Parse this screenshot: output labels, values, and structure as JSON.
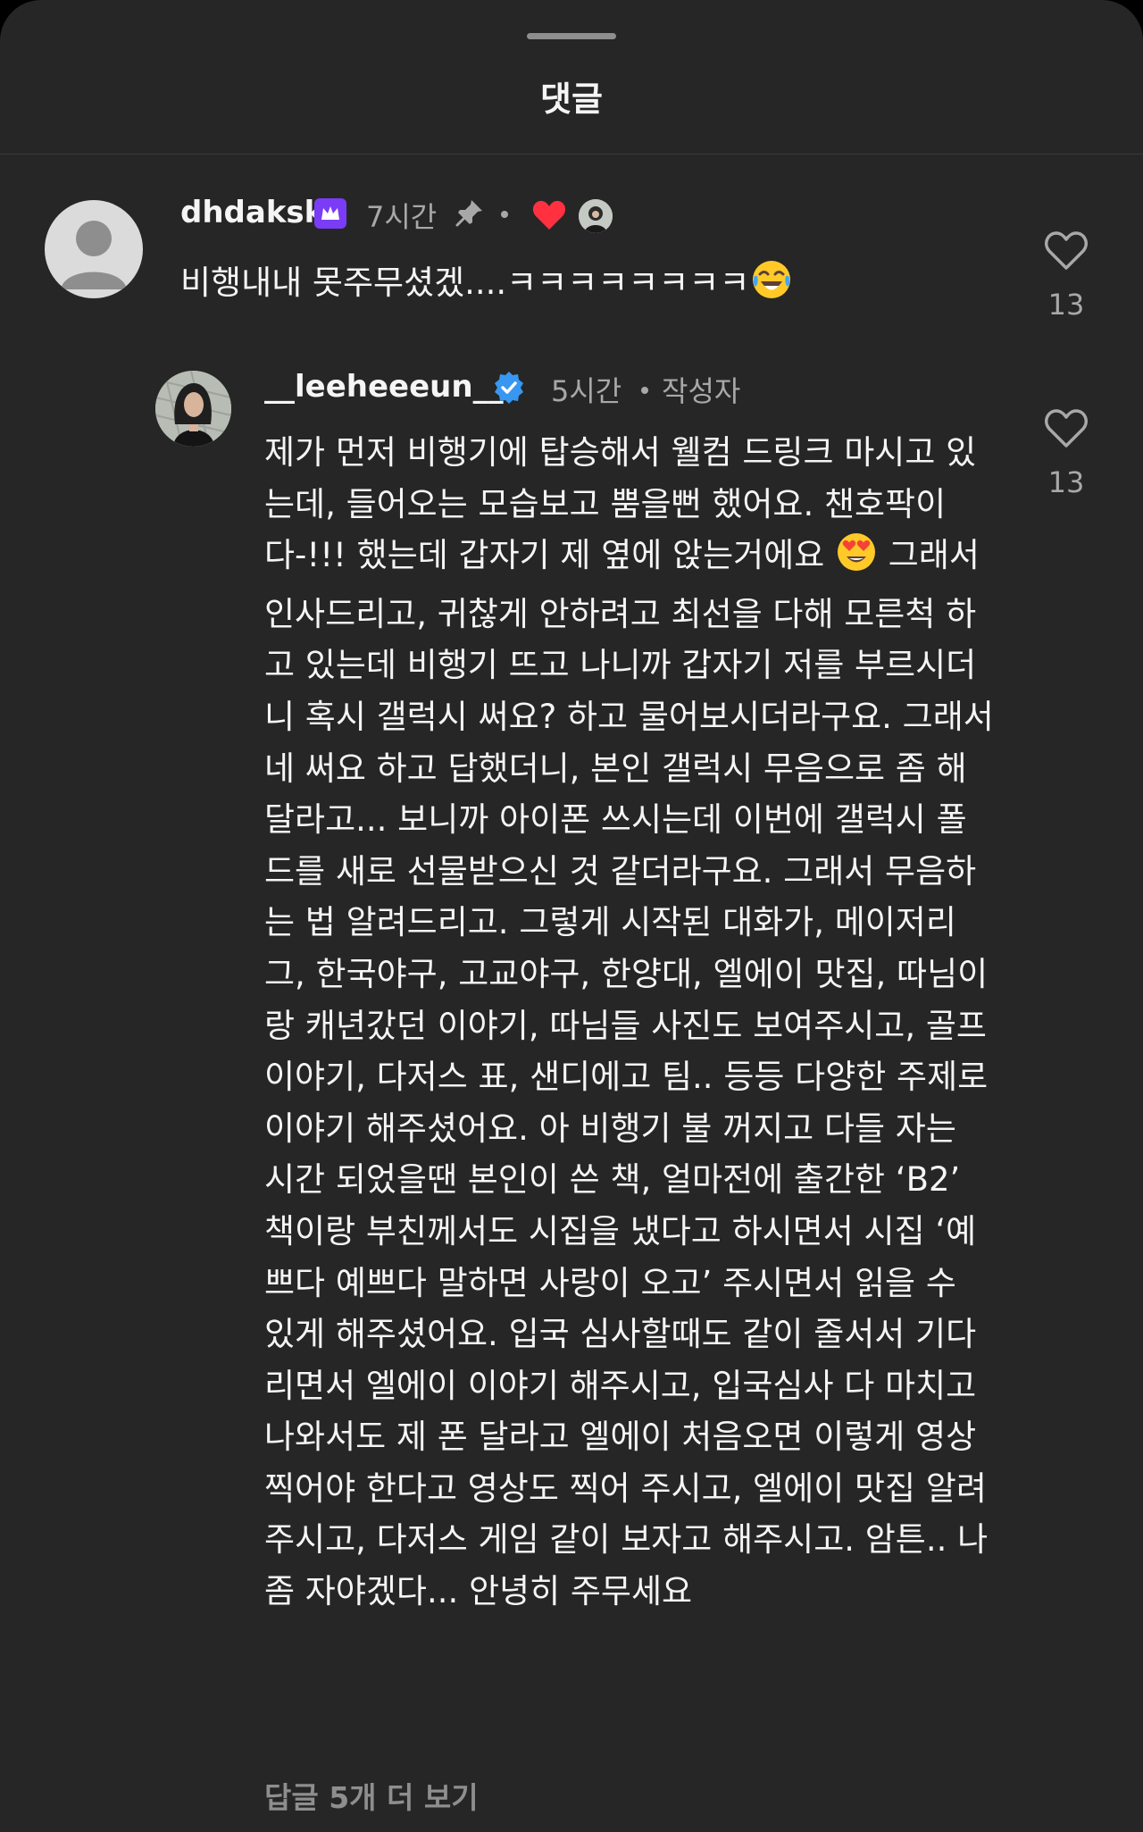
{
  "sheet": {
    "title": "댓글"
  },
  "comments": [
    {
      "username": "dhdaksk",
      "badge_icon": "crown-subscriber-icon",
      "time": "7시간",
      "pinned_icon": "pin-icon",
      "liked_by_creator_icon": "heart-icon",
      "text": "비행내내 못주무셨겠....ㅋㅋㅋㅋㅋㅋㅋㅋ",
      "emoji": "😂",
      "likes": "13"
    },
    {
      "username": "__leeheeeun__",
      "badge_icon": "verified-icon",
      "time": "5시간",
      "author_label": "작성자",
      "text_part1": "제가 먼저 비행기에 탑승해서 웰컴 드링크 마시고 있는데, 들어오는 모습보고 뿜을뻔 했어요. 챈호팍이다-!!! 했는데 갑자기 제 옆에 앉는거에요 ",
      "emoji": "😍",
      "text_part2": " 그래서 인사드리고, 귀찮게 안하려고 최선을 다해 모른척 하고 있는데 비행기 뜨고 나니까 갑자기 저를 부르시더니 혹시 갤럭시 써요? 하고 물어보시더라구요. 그래서 네 써요 하고 답했더니, 본인 갤럭시 무음으로 좀 해달라고... 보니까 아이폰 쓰시는데 이번에 갤럭시 폴드를 새로 선물받으신 것 같더라구요. 그래서 무음하는 법 알려드리고. 그렇게 시작된 대화가, 메이저리그, 한국야구, 고교야구, 한양대, 엘에이 맛집, 따님이랑 캐년갔던 이야기, 따님들 사진도 보여주시고, 골프 이야기, 다저스 표, 샌디에고 팀.. 등등 다양한 주제로 이야기 해주셨어요. 아 비행기 불 꺼지고 다들 자는 시간 되었을땐 본인이 쓴 책, 얼마전에 출간한 ‘B2’ 책이랑 부친께서도 시집을 냈다고 하시면서 시집 ‘예쁘다 예쁘다 말하면 사랑이 오고’ 주시면서 읽을 수 있게 해주셨어요. 입국 심사할때도 같이 줄서서 기다리면서 엘에이 이야기 해주시고, 입국심사 다 마치고 나와서도 제 폰 달라고 엘에이 처음오면 이렇게 영상찍어야 한다고 영상도 찍어 주시고, 엘에이 맛집 알려주시고, 다저스 게임 같이 보자고 해주시고. 암튼.. 나 좀 자야겠다... 안녕히 주무세요",
      "likes": "13",
      "more_replies": "답글 5개 더 보기"
    }
  ],
  "colors": {
    "background": "#262626",
    "text_primary": "#f5f5f5",
    "text_secondary": "#a8a8a8",
    "verified": "#3897f0",
    "subscriber_badge": "#7a3cf6",
    "heart": "#ff3040"
  }
}
